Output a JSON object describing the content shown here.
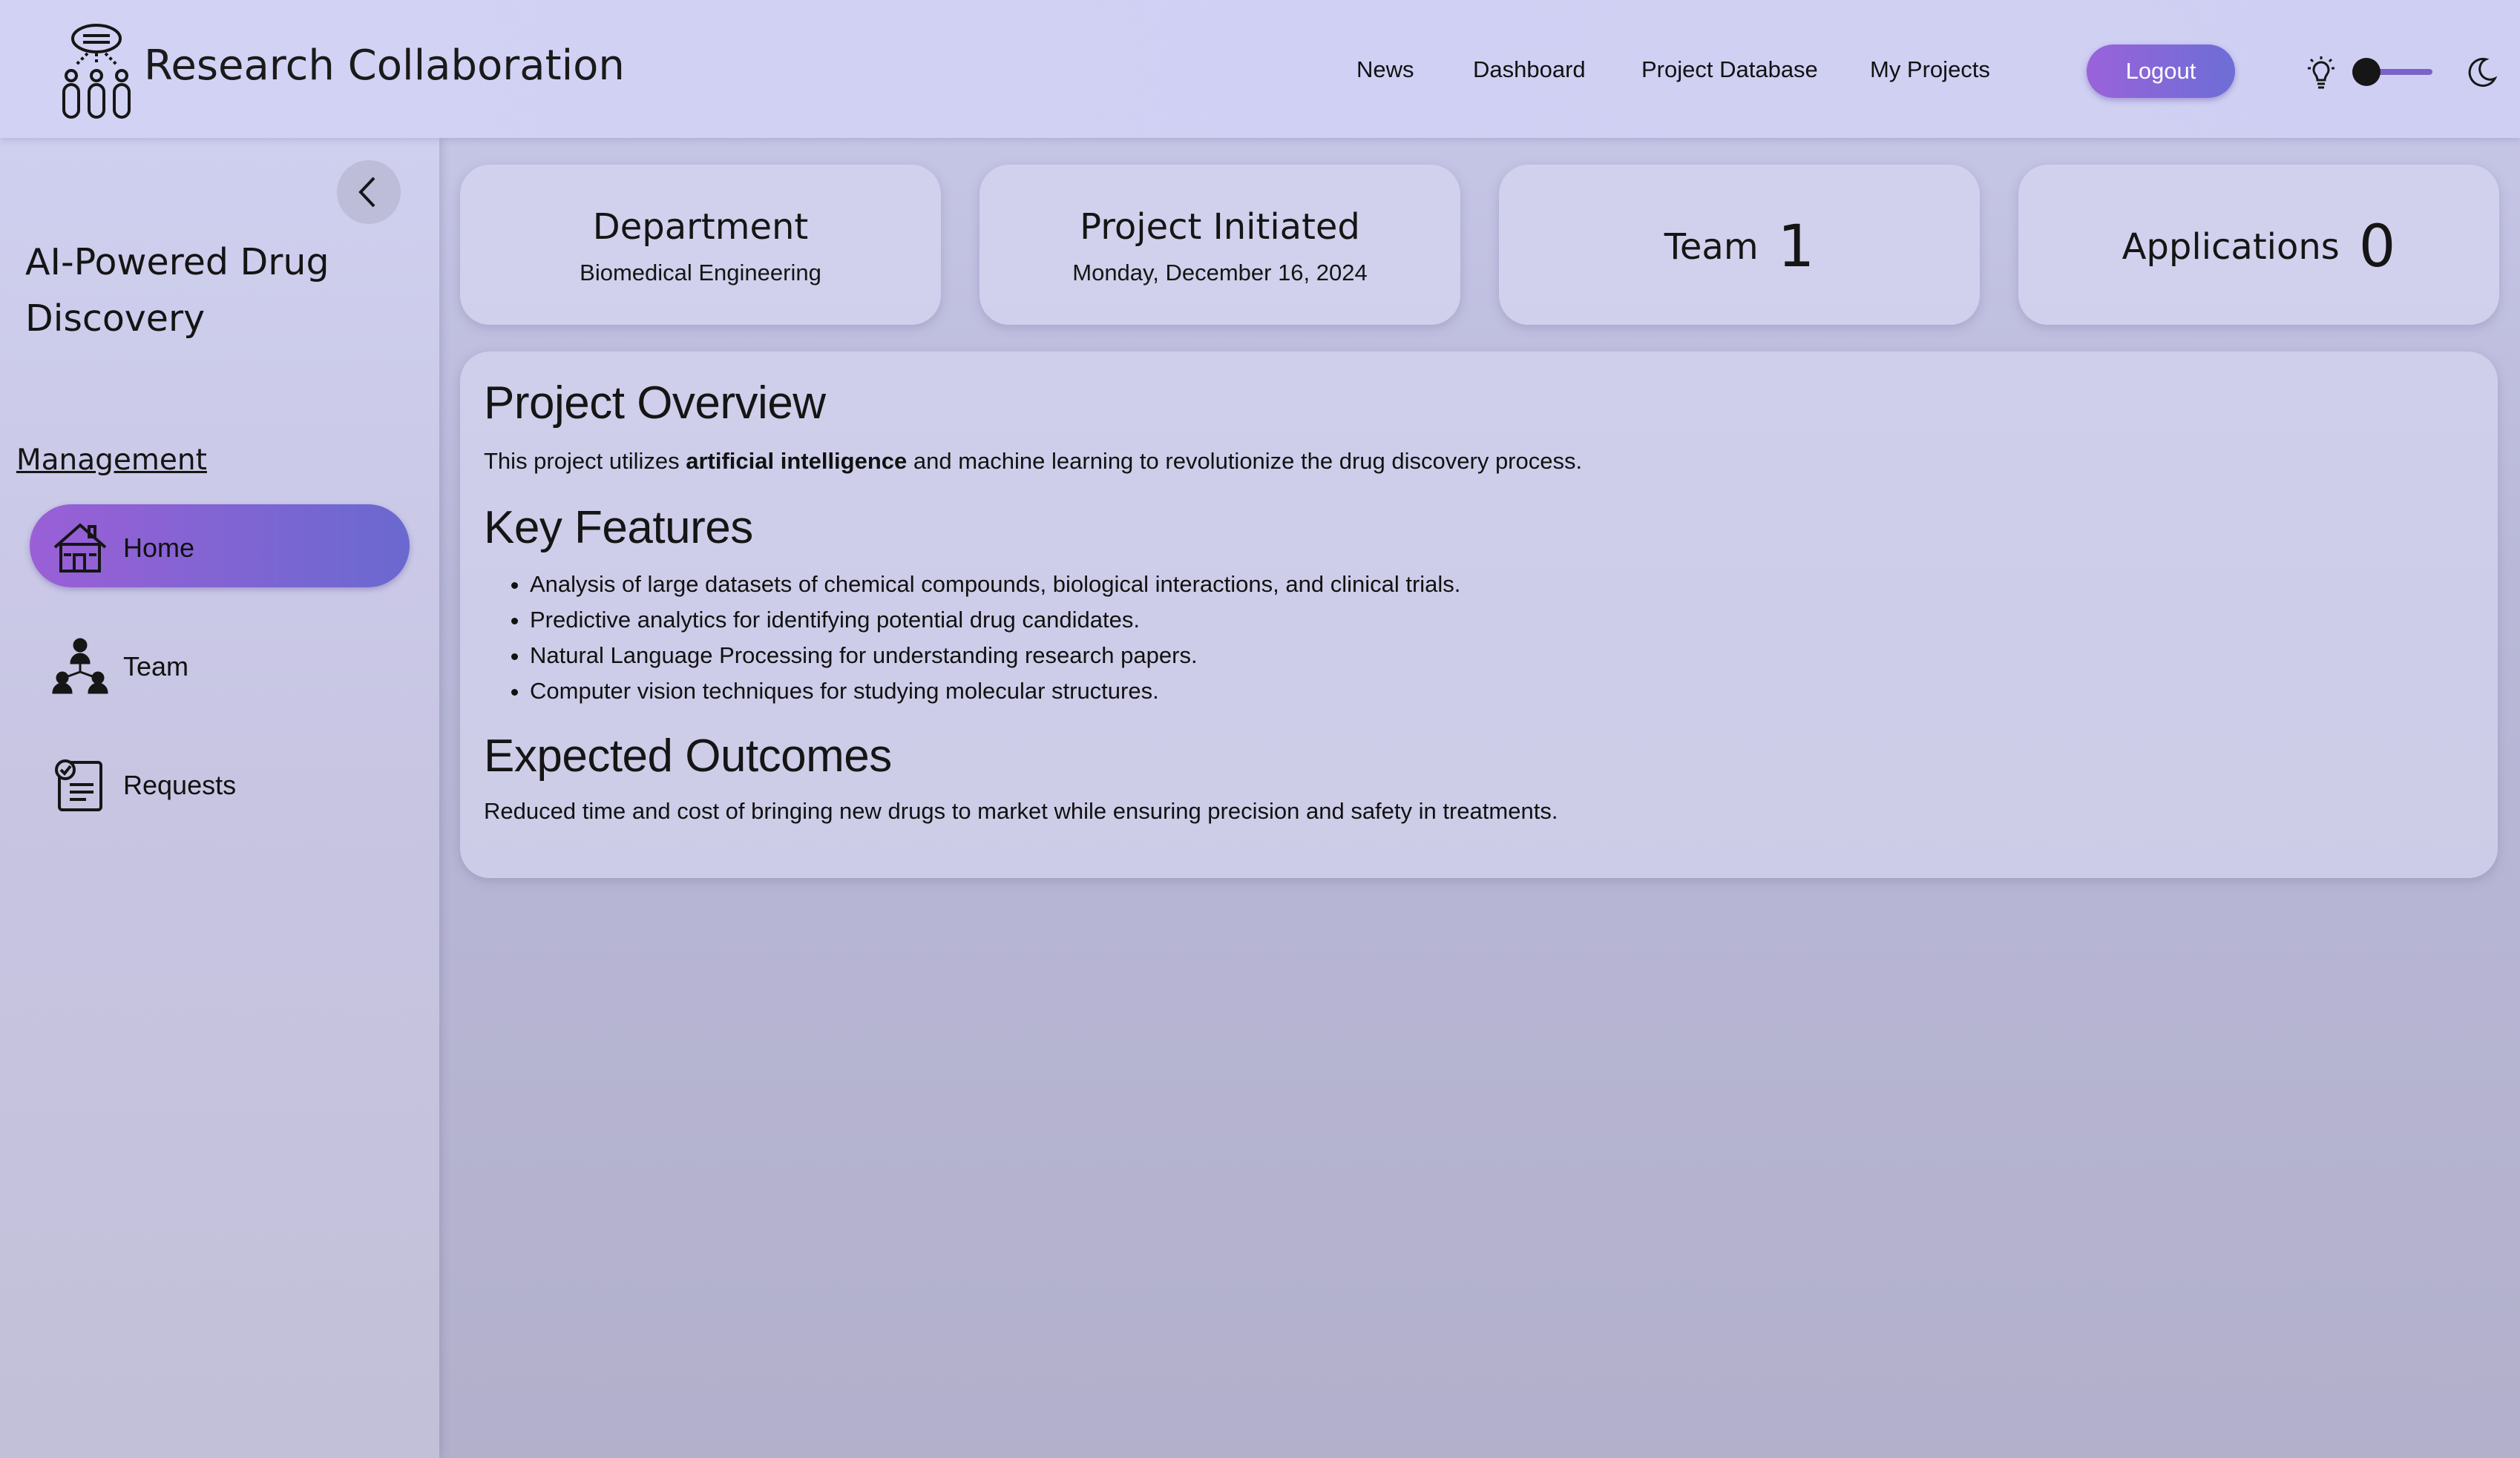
{
  "header": {
    "app_title": "Research Collaboration",
    "nav": [
      "News",
      "Dashboard",
      "Project Database",
      "My Projects"
    ],
    "logout_label": "Logout",
    "theme": {
      "light_icon": "lightbulb-icon",
      "dark_icon": "moon-icon",
      "mode": "light"
    }
  },
  "sidebar": {
    "project_title": "AI-Powered Drug Discovery",
    "section_label": "Management",
    "items": [
      {
        "label": "Home",
        "icon": "home-icon",
        "active": true
      },
      {
        "label": "Team",
        "icon": "team-icon",
        "active": false
      },
      {
        "label": "Requests",
        "icon": "requests-icon",
        "active": false
      }
    ]
  },
  "stats": {
    "department": {
      "title": "Department",
      "value": "Biomedical Engineering"
    },
    "initiated": {
      "title": "Project Initiated",
      "value": "Monday, December 16, 2024"
    },
    "team": {
      "label": "Team",
      "count": "1"
    },
    "applications": {
      "label": "Applications",
      "count": "0"
    }
  },
  "overview": {
    "heading": "Project Overview",
    "text_before": "This project utilizes ",
    "text_bold": "artificial intelligence",
    "text_after": " and machine learning to revolutionize the drug discovery process.",
    "features_heading": "Key Features",
    "features": [
      "Analysis of large datasets of chemical compounds, biological interactions, and clinical trials.",
      "Predictive analytics for identifying potential drug candidates.",
      "Natural Language Processing for understanding research papers.",
      "Computer vision techniques for studying molecular structures."
    ],
    "outcomes_heading": "Expected Outcomes",
    "outcomes_text": "Reduced time and cost of bringing new drugs to market while ensuring precision and safety in treatments."
  },
  "colors": {
    "accent_gradient_start": "#9a5fd6",
    "accent_gradient_end": "#6a69d0",
    "background": "#c9c9ea"
  }
}
